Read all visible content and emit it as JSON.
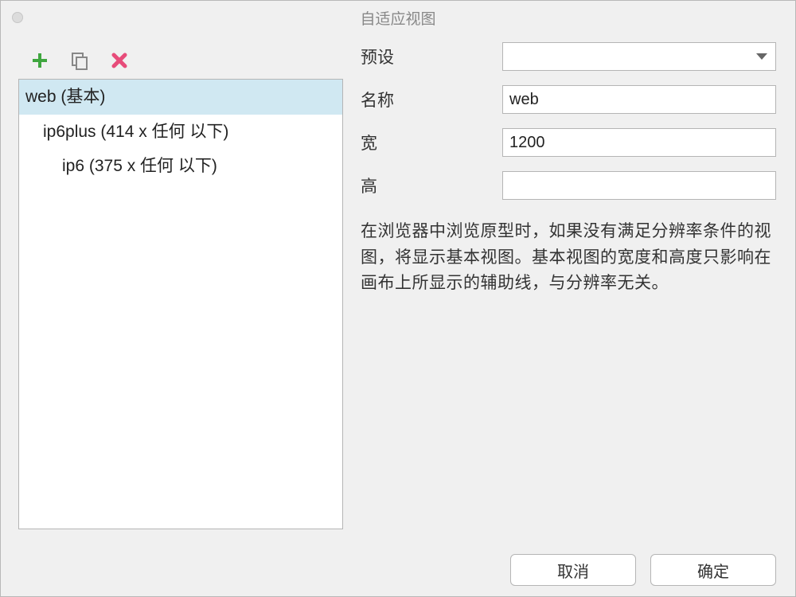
{
  "window": {
    "title": "自适应视图"
  },
  "toolbar": {
    "icons": {
      "add": "add-icon",
      "copy": "copy-icon",
      "delete": "delete-icon"
    }
  },
  "list": {
    "items": [
      {
        "label": "web (基本)",
        "indent": 0,
        "selected": true
      },
      {
        "label": "ip6plus (414 x 任何 以下)",
        "indent": 1,
        "selected": false
      },
      {
        "label": "ip6 (375 x 任何 以下)",
        "indent": 2,
        "selected": false
      }
    ]
  },
  "form": {
    "preset": {
      "label": "预设",
      "value": ""
    },
    "name": {
      "label": "名称",
      "value": "web"
    },
    "width": {
      "label": "宽",
      "value": "1200"
    },
    "height": {
      "label": "高",
      "value": ""
    }
  },
  "helpText": "在浏览器中浏览原型时，如果没有满足分辨率条件的视图，将显示基本视图。基本视图的宽度和高度只影响在画布上所显示的辅助线，与分辨率无关。",
  "buttons": {
    "cancel": "取消",
    "ok": "确定"
  }
}
